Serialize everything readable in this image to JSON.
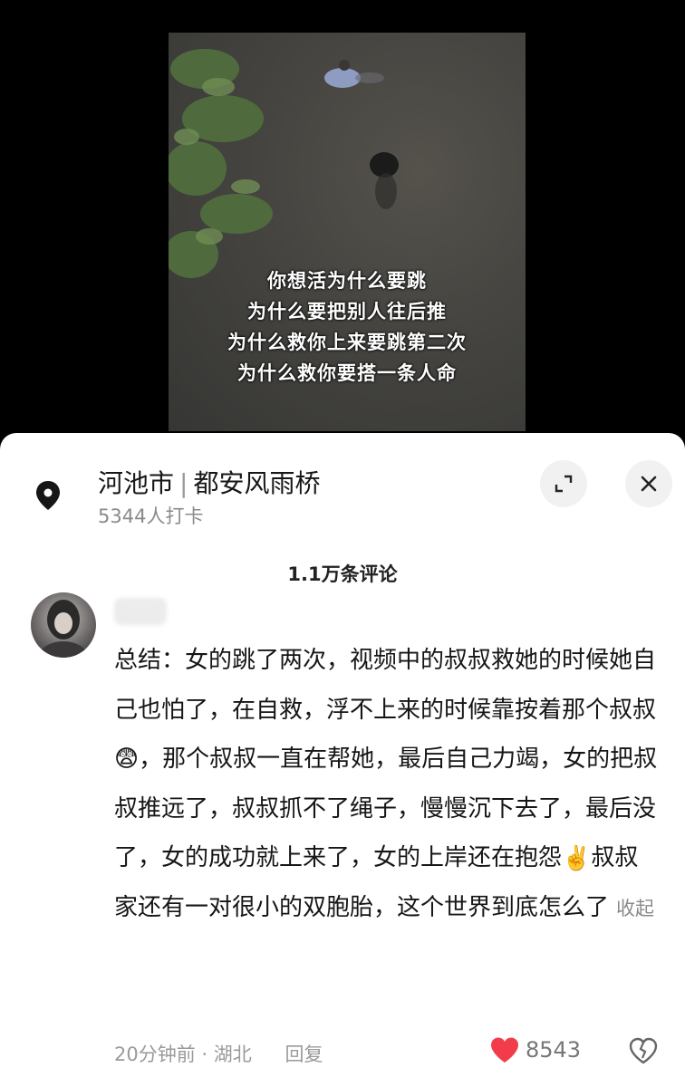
{
  "video": {
    "caption_lines": [
      "你想活为什么要跳",
      "为什么要把别人往后推",
      "为什么救你上来要跳第二次",
      "为什么救你要搭一条人命"
    ]
  },
  "location": {
    "city": "河池市",
    "place": "都安风雨桥",
    "checkins": "5344人打卡"
  },
  "comments": {
    "count_label": "1.1万条评论"
  },
  "comment": {
    "text_1": "总结：女的跳了两次，视频中的叔叔救她的时候她自己也怕了，在自救，浮不上来的时候靠按着那个叔叔",
    "emoji_1": "😨",
    "text_2": "，那个叔叔一直在帮她，最后自己力竭，女的把叔叔推远了，叔叔抓不了绳子，慢慢沉下去了，最后没了，女的成功就上来了，女的上岸还在抱怨",
    "emoji_2": "✌️",
    "text_3": "叔叔家还有一对很小的双胞胎，这个世界到底怎么了",
    "fold_label": "收起",
    "time": "20分钟前",
    "region": "湖北",
    "dot": "·",
    "reply_label": "回复",
    "likes": "8543"
  },
  "colors": {
    "like_red": "#f23c4c",
    "sheet_bg": "#ffffff"
  }
}
